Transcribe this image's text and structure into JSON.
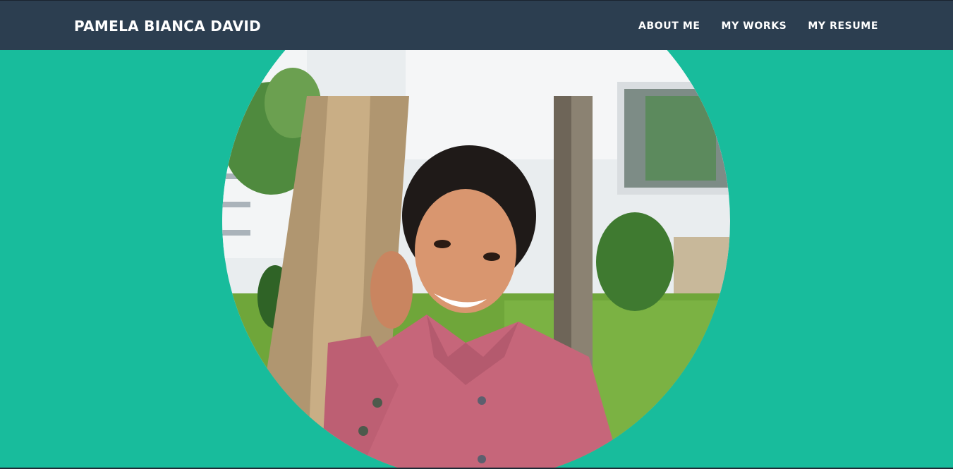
{
  "nav": {
    "brand": "PAMELA BIANCA DAVID",
    "links": [
      {
        "label": "ABOUT ME"
      },
      {
        "label": "MY WORKS"
      },
      {
        "label": "MY RESUME"
      }
    ]
  },
  "colors": {
    "navbar": "#2c3e50",
    "accent": "#18bc9c",
    "nav_text": "#ffffff"
  },
  "hero": {
    "image": "profile-portrait-photo"
  }
}
